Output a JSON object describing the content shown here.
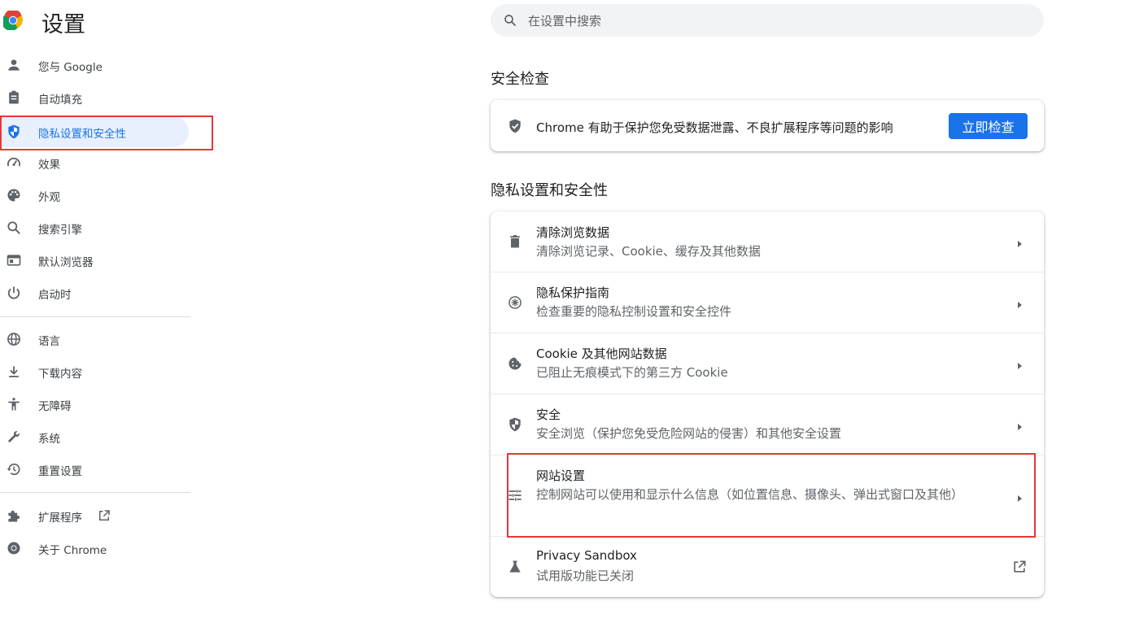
{
  "header": {
    "title": "设置",
    "logo_icon": "chrome-logo",
    "search": {
      "placeholder": "在设置中搜索",
      "icon": "search-icon"
    }
  },
  "sidebar": {
    "items": [
      {
        "label": "您与 Google",
        "icon": "person-icon"
      },
      {
        "label": "自动填充",
        "icon": "clipboard-icon"
      },
      {
        "label": "隐私设置和安全性",
        "icon": "shield-icon",
        "active": true
      },
      {
        "label": "效果",
        "icon": "speedometer-icon"
      },
      {
        "label": "外观",
        "icon": "palette-icon"
      },
      {
        "label": "搜索引擎",
        "icon": "search-icon"
      },
      {
        "label": "默认浏览器",
        "icon": "browser-window-icon"
      },
      {
        "label": "启动时",
        "icon": "power-icon"
      },
      {
        "label": "语言",
        "icon": "globe-icon"
      },
      {
        "label": "下载内容",
        "icon": "download-icon"
      },
      {
        "label": "无障碍",
        "icon": "accessibility-icon"
      },
      {
        "label": "系统",
        "icon": "wrench-icon"
      },
      {
        "label": "重置设置",
        "icon": "history-icon"
      },
      {
        "label": "扩展程序",
        "icon": "puzzle-icon",
        "external_link_icon": "open-in-new-icon"
      },
      {
        "label": "关于 Chrome",
        "icon": "chrome-icon"
      }
    ]
  },
  "main": {
    "safety_check": {
      "heading": "安全检查",
      "description": "Chrome 有助于保护您免受数据泄露、不良扩展程序等问题的影响",
      "button_label": "立即检查",
      "icon": "shield-check-icon",
      "button_color": "#1a73e8"
    },
    "privacy_security": {
      "heading": "隐私设置和安全性",
      "rows": [
        {
          "title": "清除浏览数据",
          "subtitle": "清除浏览记录、Cookie、缓存及其他数据",
          "icon": "trash-icon"
        },
        {
          "title": "隐私保护指南",
          "subtitle": "检查重要的隐私控制设置和安全控件",
          "icon": "compass-icon"
        },
        {
          "title": "Cookie 及其他网站数据",
          "subtitle": "已阻止无痕模式下的第三方 Cookie",
          "icon": "cookie-icon"
        },
        {
          "title": "安全",
          "subtitle": "安全浏览（保护您免受危险网站的侵害）和其他安全设置",
          "icon": "security-shield-icon"
        },
        {
          "title": "网站设置",
          "subtitle": "控制网站可以使用和显示什么信息（如位置信息、摄像头、弹出式窗口及其他）",
          "icon": "tune-icon"
        },
        {
          "title": "Privacy Sandbox",
          "subtitle": "试用版功能已关闭",
          "icon": "flask-icon",
          "trailing_icon": "open-in-new-icon"
        }
      ]
    }
  },
  "colors": {
    "accent": "#1a73e8",
    "active_bg": "#e8f0fe",
    "highlight_box": "#e53935",
    "secondary_text": "#5f6368"
  }
}
